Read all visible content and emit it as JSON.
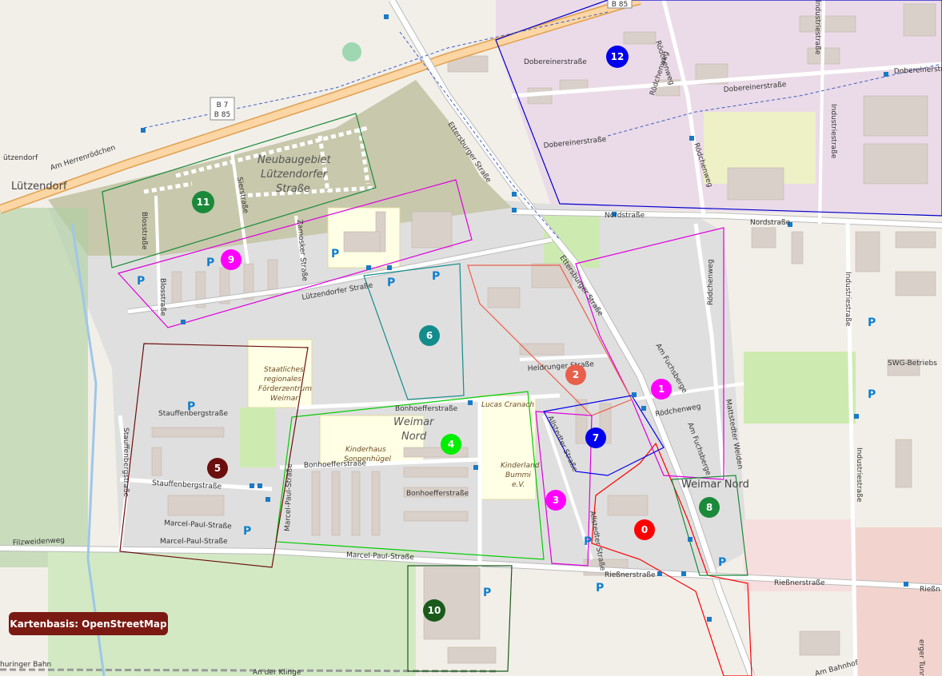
{
  "attribution": "Kartenbasis: OpenStreetMap",
  "road_shields": [
    "B 85",
    "B 7",
    "B 85"
  ],
  "places": {
    "luetzendorf": "Lützendorf",
    "luetzendorf_small": "ützendorf",
    "weimar_nord_district": "Weimar Nord"
  },
  "areas": {
    "neubaugebiet_1": "Neubaugebiet",
    "neubaugebiet_2": "Lützendorfer",
    "neubaugebiet_3": "Straße",
    "weimar_nord_1": "Weimar",
    "weimar_nord_2": "Nord"
  },
  "pois": {
    "foerderzentrum_1": "Staatliches",
    "foerderzentrum_2": "regionales",
    "foerderzentrum_3": "Förderzentrum",
    "foerderzentrum_4": "Weimar",
    "kinderhaus_1": "Kinderhaus",
    "kinderhaus_2": "Sonnenhügel",
    "lucas_cranach": "Lucas Cranach",
    "kinderland_1": "Kinderland",
    "kinderland_2": "Bummi",
    "kinderland_3": "e.V.",
    "swg": "SWG-Betriebs"
  },
  "streets": {
    "am_herrenroedchen": "Am Herrenrödchen",
    "ettersburger_1": "Ettersburger Straße",
    "ettersburger_2": "Ettersburger Straße",
    "doebereiner_1": "Dobereinerstraße",
    "doebereiner_2": "Dobereinerstraße",
    "doebereiner_3": "Dobereinerstraße",
    "doebereiner_4": "Dobereinerstra",
    "roedchenweg_1": "Rödchenweg",
    "roedchenweg_2": "Rödchenweg",
    "roedchenweg_3": "Rödchenweg",
    "roedchenweg_4": "Rödchenweg",
    "nordstrasse_1": "Nordstraße",
    "nordstrasse_2": "Nordstraße",
    "industrie_1": "Industriestraße",
    "industrie_2": "Industriestraße",
    "industrie_3": "Industriestraße",
    "industrie_4": "Industriestraße",
    "blosstrasse_1": "Blosstraße",
    "blosstrasse_2": "Blosstraße",
    "sierstrasse": "Sierstraße",
    "zamosker": "Zamosker Straße",
    "luetzendorfer": "Lützendorfer Straße",
    "heldrunger": "Heldrunger Straße",
    "am_fuchsberge_1": "Am Fuchsberge",
    "am_fuchsberge_2": "Am Fuchsberge",
    "mattstedter": "Mattstedter Weiden",
    "allstedter_1": "Allstedter Straße",
    "allstedter_2": "Allstedter Straße",
    "bonhoeffer_1": "Bonhoefferstraße",
    "bonhoeffer_2": "Bonhoefferstraße",
    "bonhoeffer_3": "Bonhoefferstraße",
    "stauffenberg_1": "Stauffenbergstraße",
    "stauffenberg_2": "Stauffenbergstraße",
    "stauffenberg_3": "Stauffenbergstraße",
    "marcel_paul_1": "Marcel-Paul-Straße",
    "marcel_paul_2": "Marcel-Paul-Straße",
    "marcel_paul_3": "Marcel-Paul-Straße",
    "marcel_paul_4": "Marcel-Paul-Straße",
    "filzweidenweg": "Filzweidenweg",
    "riessner_1": "Rießnerstraße",
    "riessner_2": "Rießnerstraße",
    "riessner_3": "Rießn",
    "am_bahnhof": "Am Bahnhof",
    "an_der_klinge": "An der Klinge",
    "thueringer_bahn": "huringer Bahn",
    "tunnel": "erger Tunnel"
  },
  "markers": [
    {
      "label": "0",
      "color": "#ff0000",
      "text_color": "#ffffff"
    },
    {
      "label": "1",
      "color": "#ff00ff",
      "text_color": "#ffffff"
    },
    {
      "label": "2",
      "color": "#e8604c",
      "text_color": "#ffffff"
    },
    {
      "label": "3",
      "color": "#ff00ff",
      "text_color": "#ffffff"
    },
    {
      "label": "4",
      "color": "#00ee00",
      "text_color": "#ffffff"
    },
    {
      "label": "5",
      "color": "#6b0f0f",
      "text_color": "#ffffff"
    },
    {
      "label": "6",
      "color": "#138c8c",
      "text_color": "#ffffff"
    },
    {
      "label": "7",
      "color": "#0000ee",
      "text_color": "#ffffff"
    },
    {
      "label": "8",
      "color": "#1a8a3a",
      "text_color": "#ffffff"
    },
    {
      "label": "9",
      "color": "#ff00ff",
      "text_color": "#ffffff"
    },
    {
      "label": "10",
      "color": "#1a5a1a",
      "text_color": "#ffffff"
    },
    {
      "label": "11",
      "color": "#1a8a3a",
      "text_color": "#ffffff"
    },
    {
      "label": "12",
      "color": "#0000ee",
      "text_color": "#ffffff"
    }
  ],
  "parking_symbol": "P",
  "colors": {
    "zone_0": "#ff0000",
    "zone_1": "#dd00dd",
    "zone_2": "#e8604c",
    "zone_4": "#00cc00",
    "zone_5": "#6b0f0f",
    "zone_6": "#138c8c",
    "zone_7": "#0000ee",
    "zone_8": "#1a8a3a",
    "zone_10": "#1a5a1a",
    "zone_11": "#1a8a3a",
    "zone_12": "#0000cc",
    "road_major": "#fcd6a4",
    "road_major_border": "#e0a050",
    "industrial": "#ebdbe8",
    "residential": "#e0dfdf",
    "building": "#d9d0c9",
    "green": "#cdebb0",
    "school": "#ffffe5"
  }
}
